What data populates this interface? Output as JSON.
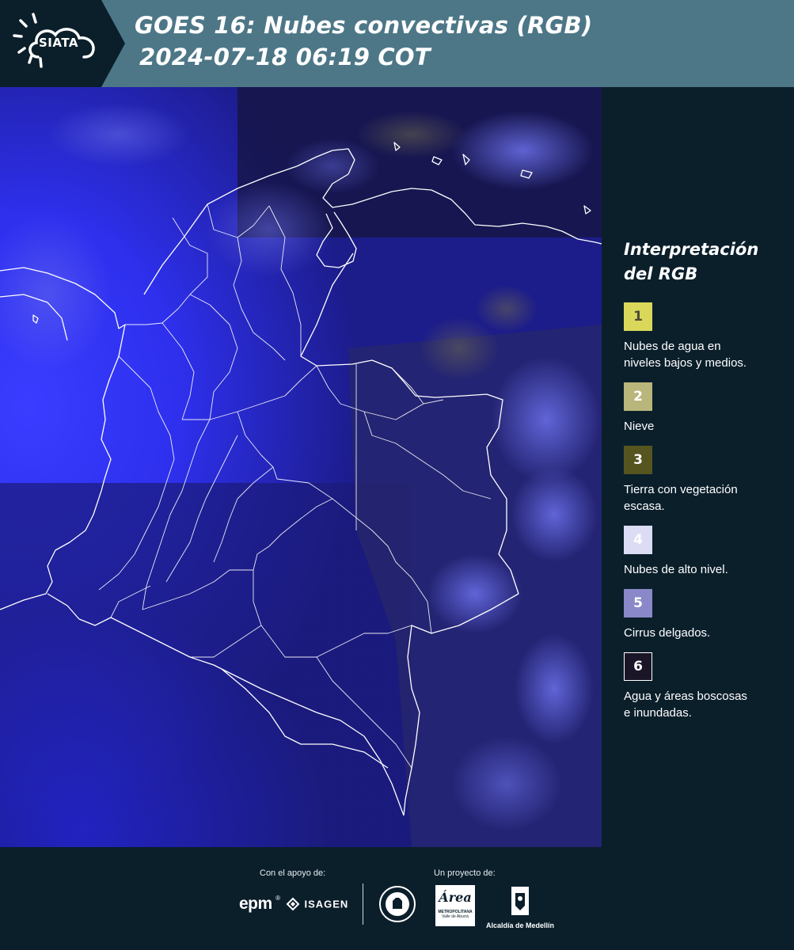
{
  "header": {
    "logo_text": "SIATA",
    "title_line1": "GOES 16: Nubes convectivas (RGB)",
    "title_line2": "2024-07-18 06:19 COT"
  },
  "map": {
    "layer": "GOES 16 RGB convective clouds composite"
  },
  "legend": {
    "title_line1": "Interpretación",
    "title_line2": "del RGB",
    "items": [
      {
        "number": "1",
        "label_line1": "Nubes de agua en",
        "label_line2": "niveles bajos y medios.",
        "color": "#d9d85a",
        "text_color": "#4a4a3a"
      },
      {
        "number": "2",
        "label_line1": "Nieve",
        "label_line2": "",
        "color": "#b8b67a",
        "text_color": "#ffffff"
      },
      {
        "number": "3",
        "label_line1": "Tierra con vegetación",
        "label_line2": "escasa.",
        "color": "#56541f",
        "text_color": "#ffffff"
      },
      {
        "number": "4",
        "label_line1": "Nubes de alto nivel.",
        "label_line2": "",
        "color": "#dcdcf5",
        "text_color": "#ffffff"
      },
      {
        "number": "5",
        "label_line1": "Cirrus delgados.",
        "label_line2": "",
        "color": "#8a88c8",
        "text_color": "#ffffff"
      },
      {
        "number": "6",
        "label_line1": "Agua y áreas boscosas",
        "label_line2": "e inundadas.",
        "color": "#1a1628",
        "text_color": "#ffffff"
      }
    ]
  },
  "footer": {
    "support_caption": "Con el apoyo de:",
    "project_caption": "Un proyecto de:",
    "sponsor_epm": "epm",
    "sponsor_isagen": "ISAGEN",
    "sponsor_area_script": "Área",
    "sponsor_area_line1": "METROPOLITANA",
    "sponsor_area_line2": "Valle de Aburrá",
    "sponsor_alcaldia": "Alcaldía de Medellín"
  },
  "colors": {
    "header_bg": "#4d7787",
    "logo_bg": "#0b1f2b",
    "page_bg": "#0b1f2b",
    "ocean_blue": "#2b2df0",
    "land_blue": "#23237a",
    "border_line": "#ffffff"
  }
}
